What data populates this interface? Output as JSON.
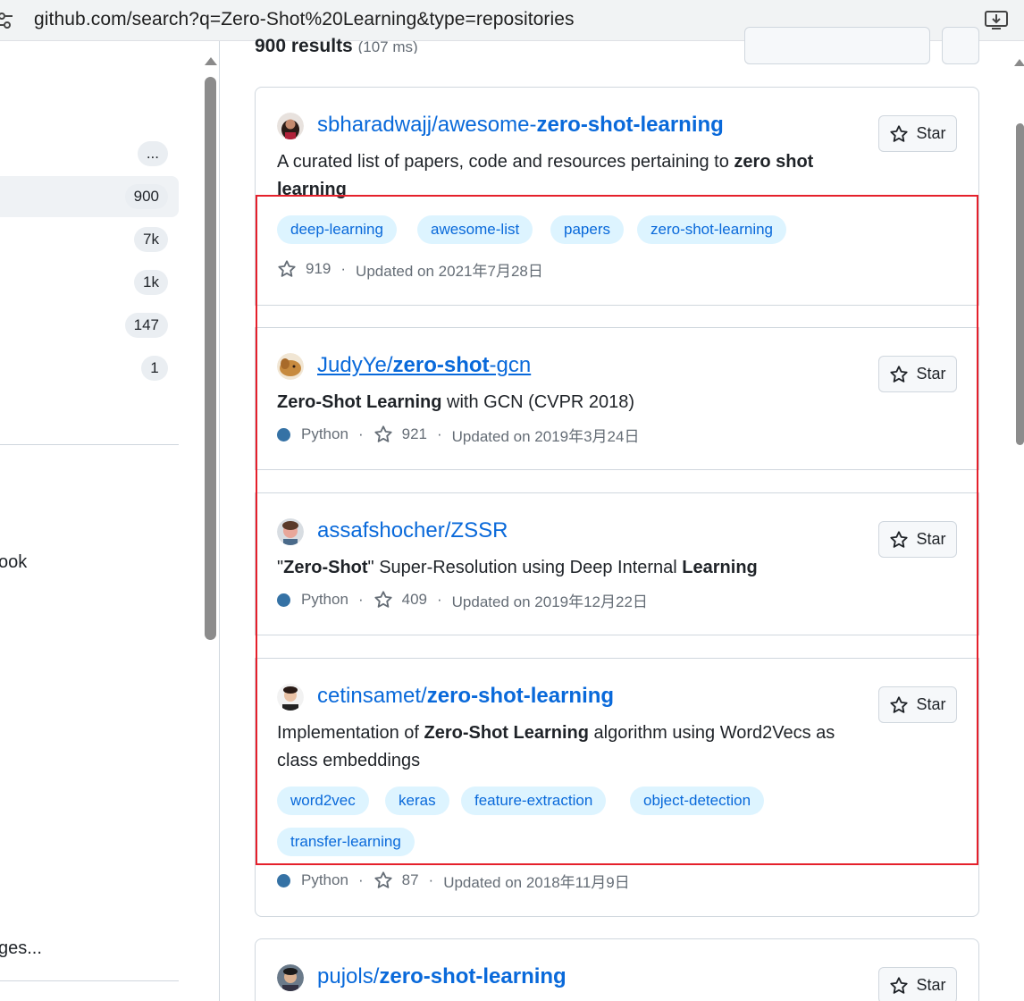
{
  "browser": {
    "url": "github.com/search?q=Zero-Shot%20Learning&type=repositories",
    "site_settings_icon": "tune-icon",
    "install_icon": "install-app-icon"
  },
  "results_header": {
    "count_text": "900 results",
    "time_text": "(107 ms)"
  },
  "sidebar": {
    "counts": [
      "...",
      "900",
      "7k",
      "1k",
      "147",
      "1"
    ],
    "clipped_labels": [
      "ook",
      "ges..."
    ],
    "dot_label": "."
  },
  "results": [
    {
      "owner": "sbharadwajj/",
      "name_prefix": "awesome-",
      "name_highlight": "zero-shot-learning",
      "name_suffix": "",
      "underlined": false,
      "desc_html_parts": [
        {
          "t": "A curated list of papers, code and resources pertaining to ",
          "b": false
        },
        {
          "t": "zero shot",
          "b": true
        },
        {
          "t": " ",
          "b": false
        },
        {
          "t": "learning",
          "b": true
        }
      ],
      "topics": [
        "deep-learning",
        "awesome-list",
        "papers",
        "zero-shot-learning"
      ],
      "language": "",
      "stars": "919",
      "updated": "Updated on 2021年7月28日",
      "star_label": "Star"
    },
    {
      "owner": "JudyYe/",
      "name_prefix": "",
      "name_highlight": "zero-shot",
      "name_suffix": "-gcn",
      "underlined": true,
      "desc_html_parts": [
        {
          "t": "Zero-Shot Learning",
          "b": true
        },
        {
          "t": " with GCN (CVPR 2018)",
          "b": false
        }
      ],
      "topics": [],
      "language": "Python",
      "stars": "921",
      "updated": "Updated on 2019年3月24日",
      "star_label": "Star"
    },
    {
      "owner": "assafshocher/",
      "name_prefix": "ZSSR",
      "name_highlight": "",
      "name_suffix": "",
      "underlined": false,
      "desc_html_parts": [
        {
          "t": "\"",
          "b": false
        },
        {
          "t": "Zero-Shot",
          "b": true
        },
        {
          "t": "\" Super-Resolution using Deep Internal ",
          "b": false
        },
        {
          "t": "Learning",
          "b": true
        }
      ],
      "topics": [],
      "language": "Python",
      "stars": "409",
      "updated": "Updated on 2019年12月22日",
      "star_label": "Star"
    },
    {
      "owner": "cetinsamet/",
      "name_prefix": "",
      "name_highlight": "zero-shot-learning",
      "name_suffix": "",
      "underlined": false,
      "desc_html_parts": [
        {
          "t": "Implementation of ",
          "b": false
        },
        {
          "t": "Zero-Shot Learning",
          "b": true
        },
        {
          "t": " algorithm using Word2Vecs as class embeddings",
          "b": false
        }
      ],
      "topics": [
        "word2vec",
        "keras",
        "feature-extraction",
        "object-detection",
        "transfer-learning"
      ],
      "language": "Python",
      "stars": "87",
      "updated": "Updated on 2018年11月9日",
      "star_label": "Star"
    },
    {
      "owner": "pujols/",
      "name_prefix": "",
      "name_highlight": "zero-shot-learning",
      "name_suffix": "",
      "underlined": false,
      "desc_html_parts": [],
      "topics": [],
      "language": "",
      "stars": "",
      "updated": "",
      "star_label": "Star"
    }
  ],
  "colors": {
    "link": "#0969da",
    "topic_bg": "#ddf4ff",
    "python": "#3572a5",
    "highlight_box": "#e5202b"
  }
}
